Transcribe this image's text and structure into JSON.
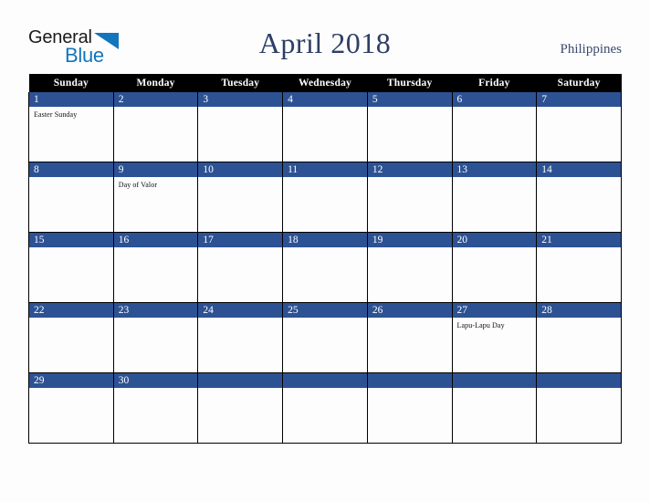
{
  "logo": {
    "word_one": "General",
    "word_two": "Blue",
    "triangle_icon": "triangle-icon",
    "colors": {
      "general": "#1b1b1b",
      "blue": "#1275bd"
    }
  },
  "header": {
    "title": "April 2018",
    "country": "Philippines",
    "title_color": "#2d3f66",
    "country_color": "#3b4a6b"
  },
  "calendar": {
    "month": "April",
    "year": "2018",
    "weekday_headers": [
      "Sunday",
      "Monday",
      "Tuesday",
      "Wednesday",
      "Thursday",
      "Friday",
      "Saturday"
    ],
    "header_bg": "#000000",
    "header_fg": "#ffffff",
    "daynum_bg": "#2d5294",
    "daynum_fg": "#ffffff",
    "cell_bg": "#fdfdfd",
    "grid_line": "#000000",
    "weeks": [
      [
        {
          "day": "1",
          "events": [
            "Easter Sunday"
          ]
        },
        {
          "day": "2",
          "events": []
        },
        {
          "day": "3",
          "events": []
        },
        {
          "day": "4",
          "events": []
        },
        {
          "day": "5",
          "events": []
        },
        {
          "day": "6",
          "events": []
        },
        {
          "day": "7",
          "events": []
        }
      ],
      [
        {
          "day": "8",
          "events": []
        },
        {
          "day": "9",
          "events": [
            "Day of Valor"
          ]
        },
        {
          "day": "10",
          "events": []
        },
        {
          "day": "11",
          "events": []
        },
        {
          "day": "12",
          "events": []
        },
        {
          "day": "13",
          "events": []
        },
        {
          "day": "14",
          "events": []
        }
      ],
      [
        {
          "day": "15",
          "events": []
        },
        {
          "day": "16",
          "events": []
        },
        {
          "day": "17",
          "events": []
        },
        {
          "day": "18",
          "events": []
        },
        {
          "day": "19",
          "events": []
        },
        {
          "day": "20",
          "events": []
        },
        {
          "day": "21",
          "events": []
        }
      ],
      [
        {
          "day": "22",
          "events": []
        },
        {
          "day": "23",
          "events": []
        },
        {
          "day": "24",
          "events": []
        },
        {
          "day": "25",
          "events": []
        },
        {
          "day": "26",
          "events": []
        },
        {
          "day": "27",
          "events": [
            "Lapu-Lapu Day"
          ]
        },
        {
          "day": "28",
          "events": []
        }
      ],
      [
        {
          "day": "29",
          "events": []
        },
        {
          "day": "30",
          "events": []
        },
        {
          "day": "",
          "events": []
        },
        {
          "day": "",
          "events": []
        },
        {
          "day": "",
          "events": []
        },
        {
          "day": "",
          "events": []
        },
        {
          "day": "",
          "events": []
        }
      ]
    ]
  }
}
